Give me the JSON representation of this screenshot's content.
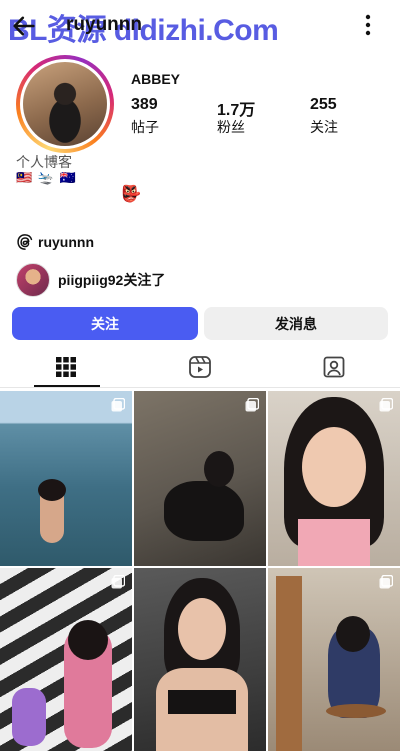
{
  "header": {
    "username": "ruyunnn",
    "watermark": "BL资源 dldizhi.Com",
    "back_icon": "arrow-left-icon",
    "more_icon": "more-vertical-icon"
  },
  "profile": {
    "display_name": "ABBEY",
    "stats": [
      {
        "value": "389",
        "label": "帖子"
      },
      {
        "value": "1.7万",
        "label": "粉丝"
      },
      {
        "value": "255",
        "label": "关注"
      }
    ],
    "bio": "个人博客",
    "flags": "🇲🇾 🛬 🇦🇺",
    "mask": "👺",
    "threads_handle": "ruyunnn"
  },
  "followed_by": {
    "text": "piigpiig92关注了"
  },
  "actions": {
    "follow_label": "关注",
    "message_label": "发消息"
  },
  "tabs": [
    {
      "icon": "grid-icon",
      "active": true
    },
    {
      "icon": "reels-icon",
      "active": false
    },
    {
      "icon": "tagged-icon",
      "active": false
    }
  ],
  "colors": {
    "accent": "#4a5cf2",
    "watermark": "#4a4fe0"
  }
}
